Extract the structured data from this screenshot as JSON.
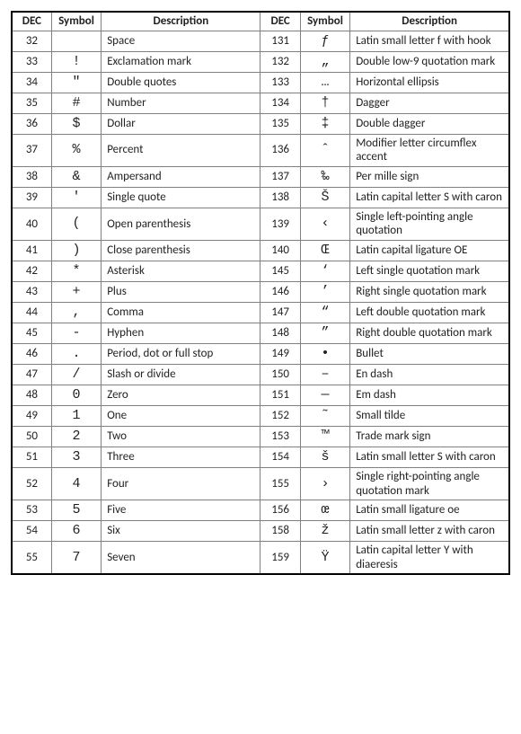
{
  "headers": {
    "dec": "DEC",
    "symbol": "Symbol",
    "description": "Description"
  },
  "rows": [
    {
      "left": {
        "dec": "32",
        "symbol": " ",
        "description": "Space"
      },
      "right": {
        "dec": "131",
        "symbol": "ƒ",
        "description": "Latin small letter f with hook"
      }
    },
    {
      "left": {
        "dec": "33",
        "symbol": "!",
        "description": "Exclamation mark"
      },
      "right": {
        "dec": "132",
        "symbol": "„",
        "description": "Double low-9 quotation mark"
      }
    },
    {
      "left": {
        "dec": "34",
        "symbol": "\"",
        "description": "Double quotes"
      },
      "right": {
        "dec": "133",
        "symbol": "…",
        "description": "Horizontal ellipsis"
      }
    },
    {
      "left": {
        "dec": "35",
        "symbol": "#",
        "description": "Number"
      },
      "right": {
        "dec": "134",
        "symbol": "†",
        "description": "Dagger"
      }
    },
    {
      "left": {
        "dec": "36",
        "symbol": "$",
        "description": "Dollar"
      },
      "right": {
        "dec": "135",
        "symbol": "‡",
        "description": "Double dagger"
      }
    },
    {
      "left": {
        "dec": "37",
        "symbol": "%",
        "description": "Percent"
      },
      "right": {
        "dec": "136",
        "symbol": "ˆ",
        "description": "Modifier letter circumflex accent"
      }
    },
    {
      "left": {
        "dec": "38",
        "symbol": "&",
        "description": "Ampersand"
      },
      "right": {
        "dec": "137",
        "symbol": "‰",
        "description": "Per mille sign"
      }
    },
    {
      "left": {
        "dec": "39",
        "symbol": "'",
        "description": "Single quote"
      },
      "right": {
        "dec": "138",
        "symbol": "Š",
        "description": "Latin capital letter S with caron"
      }
    },
    {
      "left": {
        "dec": "40",
        "symbol": "(",
        "description": "Open parenthesis"
      },
      "right": {
        "dec": "139",
        "symbol": "‹",
        "description": "Single left-pointing angle quotation"
      }
    },
    {
      "left": {
        "dec": "41",
        "symbol": ")",
        "description": "Close parenthesis"
      },
      "right": {
        "dec": "140",
        "symbol": "Œ",
        "description": "Latin capital ligature OE"
      }
    },
    {
      "left": {
        "dec": "42",
        "symbol": "*",
        "description": "Asterisk"
      },
      "right": {
        "dec": "145",
        "symbol": "‘",
        "description": "Left single quotation mark"
      }
    },
    {
      "left": {
        "dec": "43",
        "symbol": "+",
        "description": "Plus"
      },
      "right": {
        "dec": "146",
        "symbol": "’",
        "description": "Right single quotation mark"
      }
    },
    {
      "left": {
        "dec": "44",
        "symbol": ",",
        "description": "Comma"
      },
      "right": {
        "dec": "147",
        "symbol": "“",
        "description": "Left double quotation mark"
      }
    },
    {
      "left": {
        "dec": "45",
        "symbol": "-",
        "description": "Hyphen"
      },
      "right": {
        "dec": "148",
        "symbol": "”",
        "description": "Right double quotation mark"
      }
    },
    {
      "left": {
        "dec": "46",
        "symbol": ".",
        "description": "Period, dot or full stop"
      },
      "right": {
        "dec": "149",
        "symbol": "•",
        "description": "Bullet"
      }
    },
    {
      "left": {
        "dec": "47",
        "symbol": "/",
        "description": "Slash or divide"
      },
      "right": {
        "dec": "150",
        "symbol": "–",
        "description": "En dash"
      }
    },
    {
      "left": {
        "dec": "48",
        "symbol": "0",
        "description": "Zero"
      },
      "right": {
        "dec": "151",
        "symbol": "—",
        "description": "Em dash"
      }
    },
    {
      "left": {
        "dec": "49",
        "symbol": "1",
        "description": "One"
      },
      "right": {
        "dec": "152",
        "symbol": "˜",
        "description": "Small tilde"
      }
    },
    {
      "left": {
        "dec": "50",
        "symbol": "2",
        "description": "Two"
      },
      "right": {
        "dec": "153",
        "symbol": "™",
        "description": "Trade mark sign"
      }
    },
    {
      "left": {
        "dec": "51",
        "symbol": "3",
        "description": "Three"
      },
      "right": {
        "dec": "154",
        "symbol": "š",
        "description": "Latin small letter S with caron"
      }
    },
    {
      "left": {
        "dec": "52",
        "symbol": "4",
        "description": "Four"
      },
      "right": {
        "dec": "155",
        "symbol": "›",
        "description": "Single right-pointing angle quotation mark"
      }
    },
    {
      "left": {
        "dec": "53",
        "symbol": "5",
        "description": "Five"
      },
      "right": {
        "dec": "156",
        "symbol": "œ",
        "description": "Latin small ligature oe"
      }
    },
    {
      "left": {
        "dec": "54",
        "symbol": "6",
        "description": "Six"
      },
      "right": {
        "dec": "158",
        "symbol": "ž",
        "description": "Latin small letter z with caron"
      }
    },
    {
      "left": {
        "dec": "55",
        "symbol": "7",
        "description": "Seven"
      },
      "right": {
        "dec": "159",
        "symbol": "Ÿ",
        "description": "Latin capital letter Y with diaeresis"
      }
    }
  ]
}
